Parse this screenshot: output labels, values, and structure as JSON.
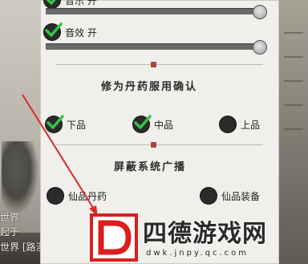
{
  "audio": {
    "music_label": "音乐 开",
    "sfx_label": "音效 开",
    "music_enabled": true,
    "sfx_enabled": true
  },
  "pill_confirm": {
    "title": "修为丹药服用确认",
    "options": [
      {
        "label": "下品",
        "checked": true
      },
      {
        "label": "中品",
        "checked": true
      },
      {
        "label": "上品",
        "checked": false
      }
    ]
  },
  "broadcast_block": {
    "title": "屏蔽系统广播",
    "options": [
      {
        "label": "仙品丹药",
        "checked": false
      },
      {
        "label": "仙品装备",
        "checked": false
      }
    ]
  },
  "background_text": {
    "line1": "世界",
    "line2": "起于",
    "line3": "世界 [路漫漫其修]"
  },
  "watermark": {
    "brand": "四德游戏网",
    "url": "dwk.jnpy.qc.com"
  },
  "colors": {
    "panel": "#f0efeb",
    "check_fill": "#2b2b2b",
    "check_mark": "#37c24a",
    "seal": "#a8453a",
    "arrow": "#d92b2b"
  }
}
